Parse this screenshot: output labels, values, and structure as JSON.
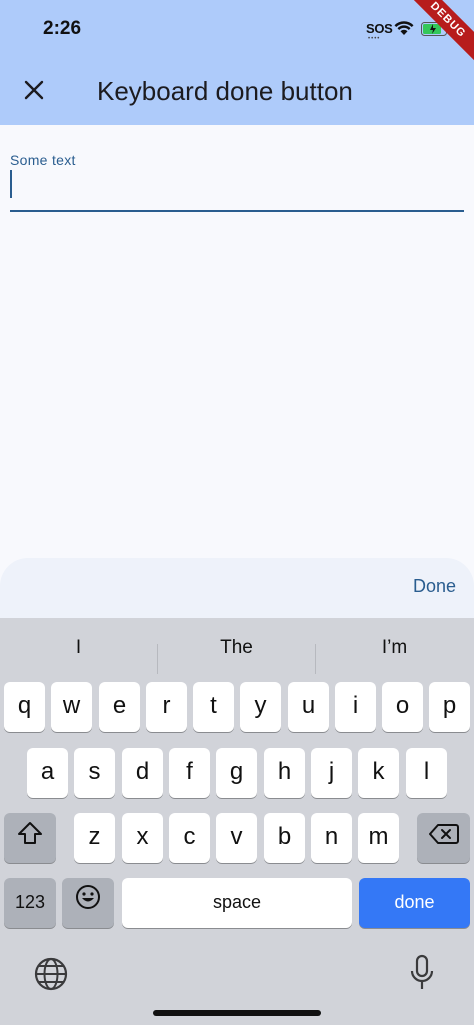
{
  "status_bar": {
    "time": "2:26",
    "sos": "SOS",
    "signal_dots": "••••",
    "debug_label": "DEBUG"
  },
  "app_bar": {
    "title": "Keyboard done button"
  },
  "form": {
    "field_label": "Some text",
    "field_value": ""
  },
  "keyboard": {
    "accessory_done": "Done",
    "suggestions": [
      "I",
      "The",
      "I’m"
    ],
    "row1": [
      "q",
      "w",
      "e",
      "r",
      "t",
      "y",
      "u",
      "i",
      "o",
      "p"
    ],
    "row2": [
      "a",
      "s",
      "d",
      "f",
      "g",
      "h",
      "j",
      "k",
      "l"
    ],
    "row3": [
      "z",
      "x",
      "c",
      "v",
      "b",
      "n",
      "m"
    ],
    "numbers_key": "123",
    "space_key": "space",
    "return_key": "done",
    "return_color": "#3478f6"
  }
}
